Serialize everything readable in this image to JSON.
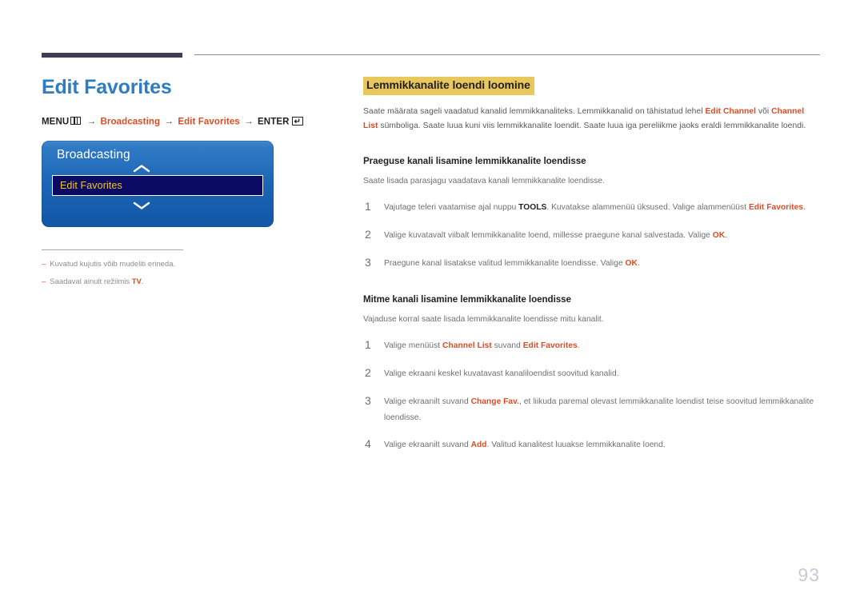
{
  "decor": {
    "rule_thick_color": "#443c52",
    "rule_thin_color": "#8a8a8a",
    "accent_blue": "#2f7dc0",
    "accent_red": "#e04a23",
    "highlight_yellow": "#e8c75d",
    "menu_gold": "#f5c518"
  },
  "left": {
    "title": "Edit Favorites",
    "breadcrumb": {
      "menu_label": "MENU",
      "menu_icon": "menu-grid-icon",
      "arrow": "→",
      "step1": "Broadcasting",
      "step2": "Edit Favorites",
      "enter_label": "ENTER",
      "enter_icon": "enter-return-icon"
    },
    "tv_menu": {
      "title": "Broadcasting",
      "up_icon": "chevron-up-icon",
      "down_icon": "chevron-down-icon",
      "selected_item": "Edit Favorites"
    },
    "notes": [
      {
        "dash": "‒",
        "text": "Kuvatud kujutis võib mudeliti erineda.",
        "highlight": ""
      },
      {
        "dash": "‒",
        "pre": "Saadaval ainult režiimis ",
        "highlight": "TV",
        "post": "."
      }
    ]
  },
  "right": {
    "section_heading": "Lemmikkanalite loendi loomine",
    "intro": {
      "part1": "Saate määrata sageli vaadatud kanalid lemmikkanaliteks. Lemmikkanalid on tähistatud lehel ",
      "key1": "Edit Channel",
      "part2": " või ",
      "key2": "Channel List",
      "part3": " sümboliga. Saate luua kuni viis lemmikkanalite loendit. Saate luua iga pereliikme jaoks eraldi lemmikkanalite loendi."
    },
    "sections": [
      {
        "heading": "Praeguse kanali lisamine lemmikkanalite loendisse",
        "description": "Saate lisada parasjagu vaadatava kanali lemmikkanalite loendisse.",
        "steps": [
          {
            "num": "1",
            "segments": [
              {
                "t": "Vajutage teleri vaatamise ajal nuppu ",
                "s": "plain"
              },
              {
                "t": "TOOLS",
                "s": "bold"
              },
              {
                "t": ". Kuvatakse alammenüü üksused. Valige alammenüüst ",
                "s": "plain"
              },
              {
                "t": "Edit Favorites",
                "s": "key"
              },
              {
                "t": ".",
                "s": "plain"
              }
            ]
          },
          {
            "num": "2",
            "segments": [
              {
                "t": "Valige kuvatavalt viibalt lemmikkanalite loend, millesse praegune kanal salvestada. Valige ",
                "s": "plain"
              },
              {
                "t": "OK",
                "s": "key"
              },
              {
                "t": ".",
                "s": "plain"
              }
            ]
          },
          {
            "num": "3",
            "segments": [
              {
                "t": "Praegune kanal lisatakse valitud lemmikkanalite loendisse. Valige ",
                "s": "plain"
              },
              {
                "t": "OK",
                "s": "key"
              },
              {
                "t": ".",
                "s": "plain"
              }
            ]
          }
        ]
      },
      {
        "heading": "Mitme kanali lisamine lemmikkanalite loendisse",
        "description": "Vajaduse korral saate lisada lemmikkanalite loendisse mitu kanalit.",
        "steps": [
          {
            "num": "1",
            "segments": [
              {
                "t": "Valige menüüst ",
                "s": "plain"
              },
              {
                "t": "Channel List",
                "s": "key"
              },
              {
                "t": " suvand ",
                "s": "plain"
              },
              {
                "t": "Edit Favorites",
                "s": "key"
              },
              {
                "t": ".",
                "s": "plain"
              }
            ]
          },
          {
            "num": "2",
            "segments": [
              {
                "t": "Valige ekraani keskel kuvatavast kanaliloendist soovitud kanalid.",
                "s": "plain"
              }
            ]
          },
          {
            "num": "3",
            "segments": [
              {
                "t": "Valige ekraanilt suvand ",
                "s": "plain"
              },
              {
                "t": "Change Fav.",
                "s": "key"
              },
              {
                "t": ", et liikuda paremal olevast lemmikkanalite loendist teise soovitud lemmikkanalite loendisse.",
                "s": "plain"
              }
            ]
          },
          {
            "num": "4",
            "segments": [
              {
                "t": "Valige ekraanilt suvand ",
                "s": "plain"
              },
              {
                "t": "Add",
                "s": "key"
              },
              {
                "t": ". Valitud kanalitest luuakse lemmikkanalite loend.",
                "s": "plain"
              }
            ]
          }
        ]
      }
    ]
  },
  "footer": {
    "page_number": "93"
  }
}
